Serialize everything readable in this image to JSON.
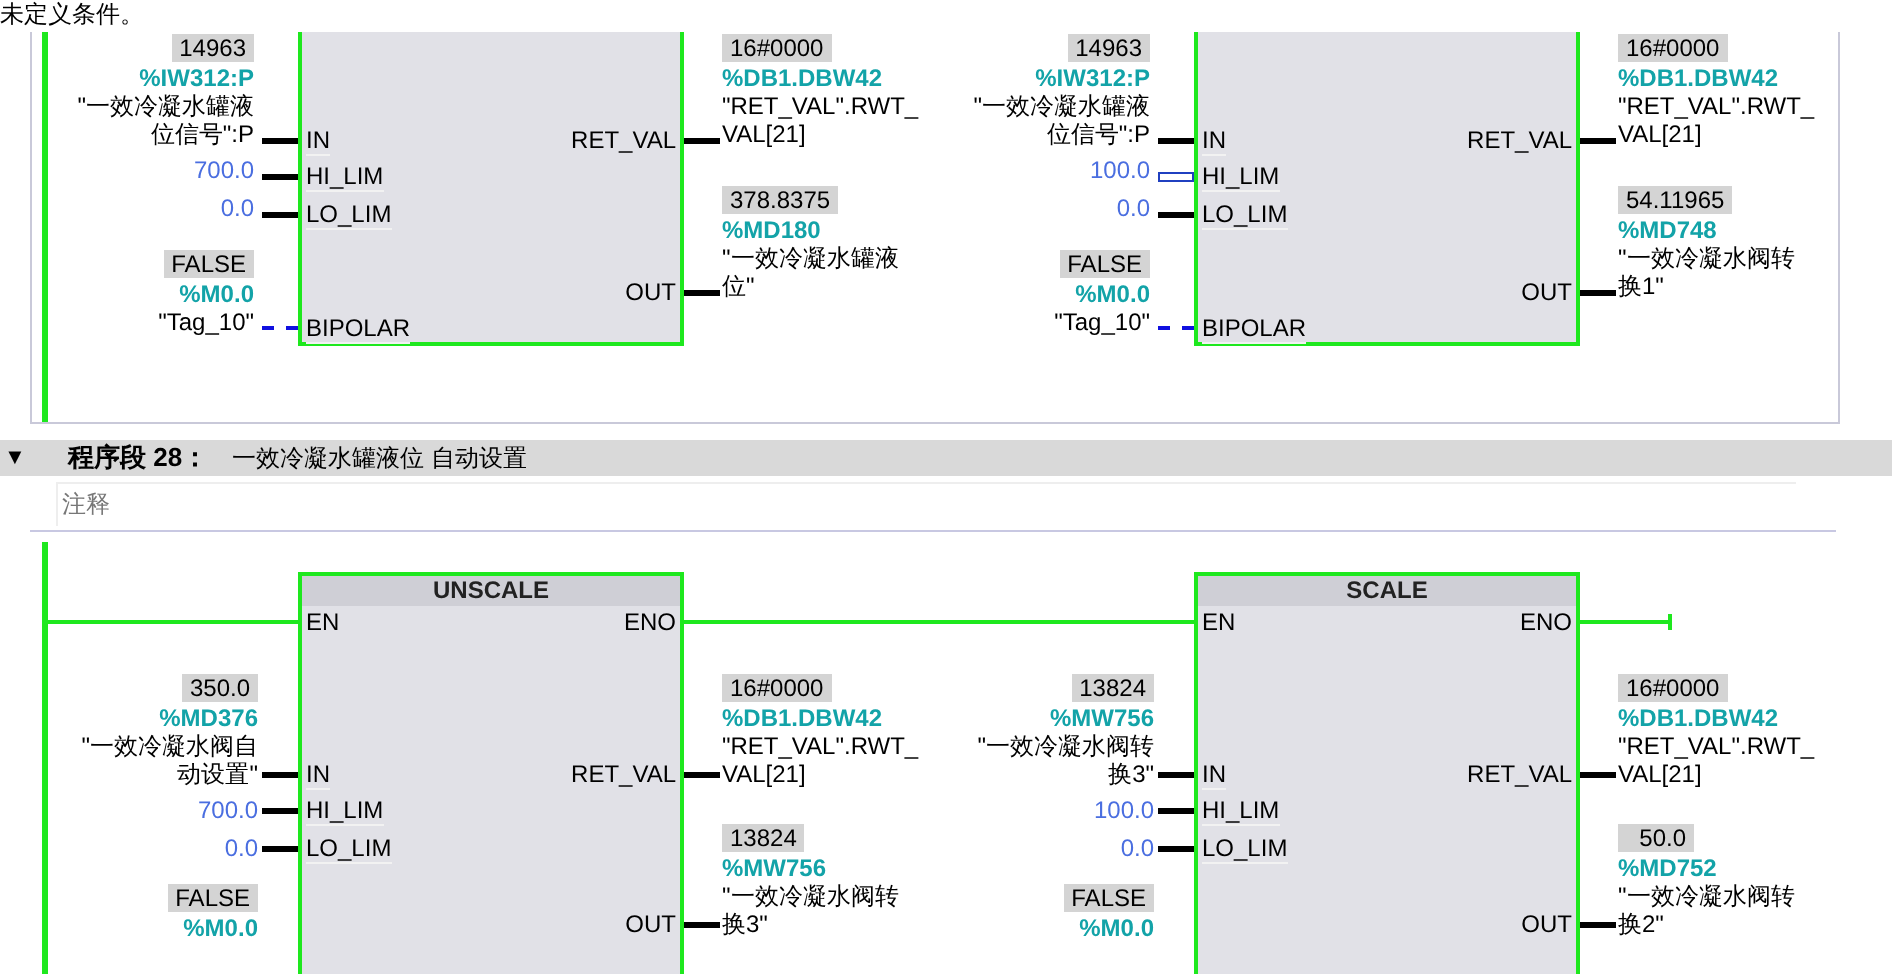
{
  "note": "未定义条件。",
  "networks": [
    {
      "blocks": [
        {
          "inputs": [
            {
              "pin": "IN",
              "kind": "operand",
              "dashed": false,
              "double": false,
              "value": "14963",
              "address": "%IW312:P",
              "symbol": [
                "\"一效冷凝水罐液",
                "位信号\":P"
              ]
            },
            {
              "pin": "HI_LIM",
              "kind": "constant",
              "dashed": false,
              "double": false,
              "value": "700.0"
            },
            {
              "pin": "LO_LIM",
              "kind": "constant",
              "dashed": false,
              "double": false,
              "value": "0.0"
            },
            {
              "pin": "BIPOLAR",
              "kind": "operand",
              "dashed": true,
              "double": false,
              "value": "FALSE",
              "address": "%M0.0",
              "symbol": [
                "\"Tag_10\""
              ]
            }
          ],
          "outputs": [
            {
              "pin": "RET_VAL",
              "value": "16#0000",
              "address": "%DB1.DBW42",
              "symbol": [
                "\"RET_VAL\".RWT_",
                "VAL[21]"
              ]
            },
            {
              "pin": "OUT",
              "value": "378.8375",
              "address": "%MD180",
              "symbol": [
                "\"一效冷凝水罐液",
                "位\""
              ]
            }
          ]
        },
        {
          "inputs": [
            {
              "pin": "IN",
              "kind": "operand",
              "dashed": false,
              "double": false,
              "value": "14963",
              "address": "%IW312:P",
              "symbol": [
                "\"一效冷凝水罐液",
                "位信号\":P"
              ]
            },
            {
              "pin": "HI_LIM",
              "kind": "constant",
              "dashed": false,
              "double": true,
              "value": "100.0"
            },
            {
              "pin": "LO_LIM",
              "kind": "constant",
              "dashed": false,
              "double": false,
              "value": "0.0"
            },
            {
              "pin": "BIPOLAR",
              "kind": "operand",
              "dashed": true,
              "double": false,
              "value": "FALSE",
              "address": "%M0.0",
              "symbol": [
                "\"Tag_10\""
              ]
            }
          ],
          "outputs": [
            {
              "pin": "RET_VAL",
              "value": "16#0000",
              "address": "%DB1.DBW42",
              "symbol": [
                "\"RET_VAL\".RWT_",
                "VAL[21]"
              ]
            },
            {
              "pin": "OUT",
              "value": "54.11965",
              "address": "%MD748",
              "symbol": [
                "\"一效冷凝水阀转",
                "换1\""
              ]
            }
          ]
        }
      ]
    },
    {
      "header": {
        "toggle": "▼",
        "label": "程序段",
        "number": "28：",
        "title": "一效冷凝水罐液位 自动设置"
      },
      "comment": "注释",
      "blocks": [
        {
          "title": "UNSCALE",
          "en": "EN",
          "eno": "ENO",
          "inputs": [
            {
              "pin": "IN",
              "kind": "operand",
              "dashed": false,
              "double": false,
              "value": "350.0",
              "address": "%MD376",
              "symbol": [
                "\"一效冷凝水阀自",
                "动设置\""
              ]
            },
            {
              "pin": "HI_LIM",
              "kind": "constant",
              "dashed": false,
              "double": false,
              "value": "700.0"
            },
            {
              "pin": "LO_LIM",
              "kind": "constant",
              "dashed": false,
              "double": false,
              "value": "0.0"
            },
            {
              "kind": "operand",
              "value": "FALSE",
              "address": "%M0.0"
            }
          ],
          "outputs": [
            {
              "pin": "RET_VAL",
              "value": "16#0000",
              "address": "%DB1.DBW42",
              "symbol": [
                "\"RET_VAL\".RWT_",
                "VAL[21]"
              ]
            },
            {
              "pin": "OUT",
              "value": "13824",
              "address": "%MW756",
              "symbol": [
                "\"一效冷凝水阀转",
                "换3\""
              ]
            }
          ]
        },
        {
          "title": "SCALE",
          "en": "EN",
          "eno": "ENO",
          "inputs": [
            {
              "pin": "IN",
              "kind": "operand",
              "dashed": false,
              "double": false,
              "value": "13824",
              "address": "%MW756",
              "symbol": [
                "\"一效冷凝水阀转",
                "换3\""
              ]
            },
            {
              "pin": "HI_LIM",
              "kind": "constant",
              "dashed": false,
              "double": false,
              "value": "100.0"
            },
            {
              "pin": "LO_LIM",
              "kind": "constant",
              "dashed": false,
              "double": false,
              "value": "0.0"
            },
            {
              "kind": "operand",
              "value": "FALSE",
              "address": "%M0.0"
            }
          ],
          "outputs": [
            {
              "pin": "RET_VAL",
              "value": "16#0000",
              "address": "%DB1.DBW42",
              "symbol": [
                "\"RET_VAL\".RWT_",
                "VAL[21]"
              ]
            },
            {
              "pin": "OUT",
              "value": "50.0",
              "address": "%MD752",
              "symbol": [
                "\"一效冷凝水阀转",
                "换2\""
              ]
            }
          ]
        }
      ]
    }
  ]
}
